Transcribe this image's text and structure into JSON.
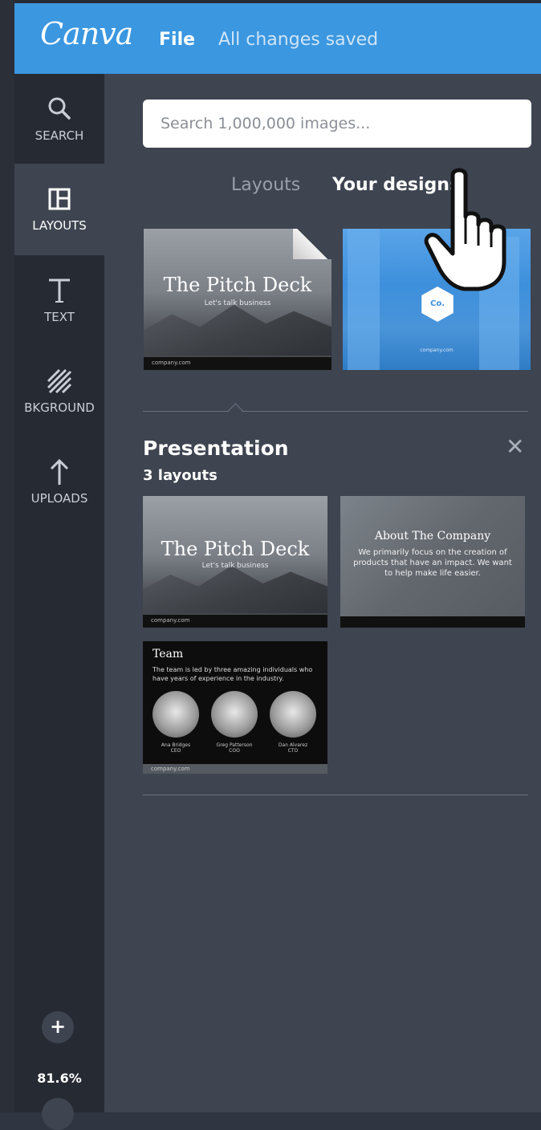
{
  "header": {
    "logo": "Canva",
    "file_label": "File",
    "status": "All changes saved"
  },
  "sidebar": {
    "items": [
      {
        "label": "SEARCH",
        "icon": "search-icon"
      },
      {
        "label": "LAYOUTS",
        "icon": "layouts-icon"
      },
      {
        "label": "TEXT",
        "icon": "text-icon"
      },
      {
        "label": "BKGROUND",
        "icon": "background-icon"
      },
      {
        "label": "UPLOADS",
        "icon": "upload-icon"
      }
    ],
    "active": "LAYOUTS",
    "zoom_in": "+",
    "zoom_level": "81.6%"
  },
  "panel": {
    "search_placeholder": "Search 1,000,000 images...",
    "tabs": [
      {
        "label": "Layouts",
        "active": false
      },
      {
        "label": "Your designs",
        "active": true
      }
    ],
    "designs": [
      {
        "title": "The Pitch Deck",
        "subtitle": "Let's talk business",
        "footer": "company.com"
      },
      {
        "badge": "Co.",
        "footer": "company.com"
      }
    ],
    "section": {
      "title": "Presentation",
      "count": "3 layouts",
      "close": "✕",
      "layouts": [
        {
          "title": "The Pitch Deck",
          "subtitle": "Let's talk business",
          "footer": "company.com"
        },
        {
          "title": "About The Company",
          "body": "We primarily focus on the creation of products that have an impact. We want to help make life easier."
        },
        {
          "title": "Team",
          "body": "The team is led by three amazing individuals who have years of experience in the industry.",
          "people": [
            {
              "name": "Ana Bridges",
              "role": "CEO"
            },
            {
              "name": "Greg Patterson",
              "role": "COO"
            },
            {
              "name": "Dan Alvarez",
              "role": "CTO"
            }
          ],
          "footer": "company.com"
        }
      ]
    }
  },
  "colors": {
    "topbar": "#3b97e0",
    "sidebar": "#262b33",
    "panel": "#3e4450"
  }
}
